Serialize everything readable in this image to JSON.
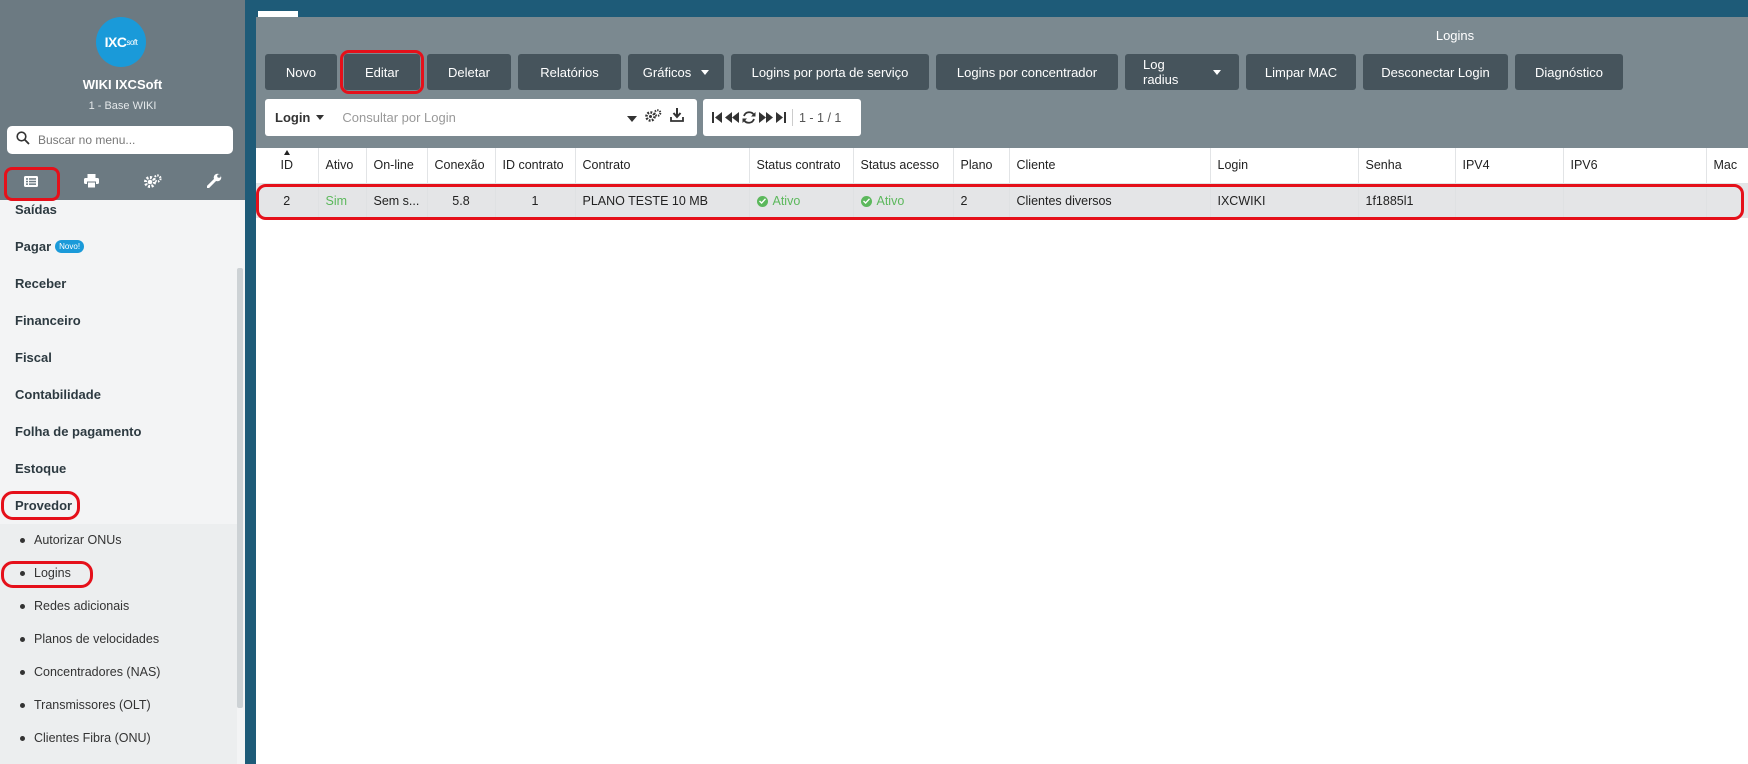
{
  "sidebar": {
    "brand_logo": "IXCsoft",
    "brand_logo_main": "IXC",
    "brand_logo_small": "soft",
    "brand_name": "WIKI IXCSoft",
    "brand_sub": "1 - Base WIKI",
    "search_placeholder": "Buscar no menu...",
    "tabs": [
      "list-icon",
      "printer-icon",
      "gears-icon",
      "wrench-icon"
    ],
    "menu": [
      {
        "label": "Saídas"
      },
      {
        "label": "Pagar",
        "badge": "Novo!"
      },
      {
        "label": "Receber"
      },
      {
        "label": "Financeiro"
      },
      {
        "label": "Fiscal"
      },
      {
        "label": "Contabilidade"
      },
      {
        "label": "Folha de pagamento"
      },
      {
        "label": "Estoque"
      },
      {
        "label": "Provedor"
      }
    ],
    "submenu": [
      {
        "label": "Autorizar ONUs"
      },
      {
        "label": "Logins"
      },
      {
        "label": "Redes adicionais"
      },
      {
        "label": "Planos de velocidades"
      },
      {
        "label": "Concentradores (NAS)"
      },
      {
        "label": "Transmissores (OLT)"
      },
      {
        "label": "Clientes Fibra (ONU)"
      }
    ]
  },
  "main": {
    "title": "Logins",
    "buttons": [
      {
        "label": "Novo"
      },
      {
        "label": "Editar"
      },
      {
        "label": "Deletar"
      },
      {
        "label": "Relatórios"
      },
      {
        "label": "Gráficos",
        "dropdown": true
      },
      {
        "label": "Logins por porta de serviço"
      },
      {
        "label": "Logins por concentrador"
      },
      {
        "label": "Log radius",
        "dropdown": true
      },
      {
        "label": "Limpar MAC"
      },
      {
        "label": "Desconectar Login"
      },
      {
        "label": "Diagnóstico"
      }
    ],
    "search": {
      "field": "Login",
      "placeholder": "Consultar por Login"
    },
    "pager": {
      "text": "1 - 1 / 1"
    },
    "table": {
      "columns": [
        "ID",
        "Ativo",
        "On-line",
        "Conexão",
        "ID contrato",
        "Contrato",
        "Status contrato",
        "Status acesso",
        "Plano",
        "Cliente",
        "Login",
        "Senha",
        "IPV4",
        "IPV6",
        "Mac"
      ],
      "rows": [
        {
          "id": "2",
          "ativo": "Sim",
          "online": "Sem s...",
          "conexao": "5.8",
          "id_contrato": "1",
          "contrato": "PLANO TESTE 10 MB",
          "status_contrato": "Ativo",
          "status_acesso": "Ativo",
          "plano": "2",
          "cliente": "Clientes diversos",
          "login": "IXCWIKI",
          "senha": "1f1885l1",
          "ipv4": "",
          "ipv6": "",
          "mac": ""
        }
      ]
    }
  },
  "colors": {
    "accent": "#1a9ad9",
    "highlight": "#e5101a",
    "toolbar": "#7b8990",
    "button": "#46545c",
    "success": "#5cb85c"
  }
}
